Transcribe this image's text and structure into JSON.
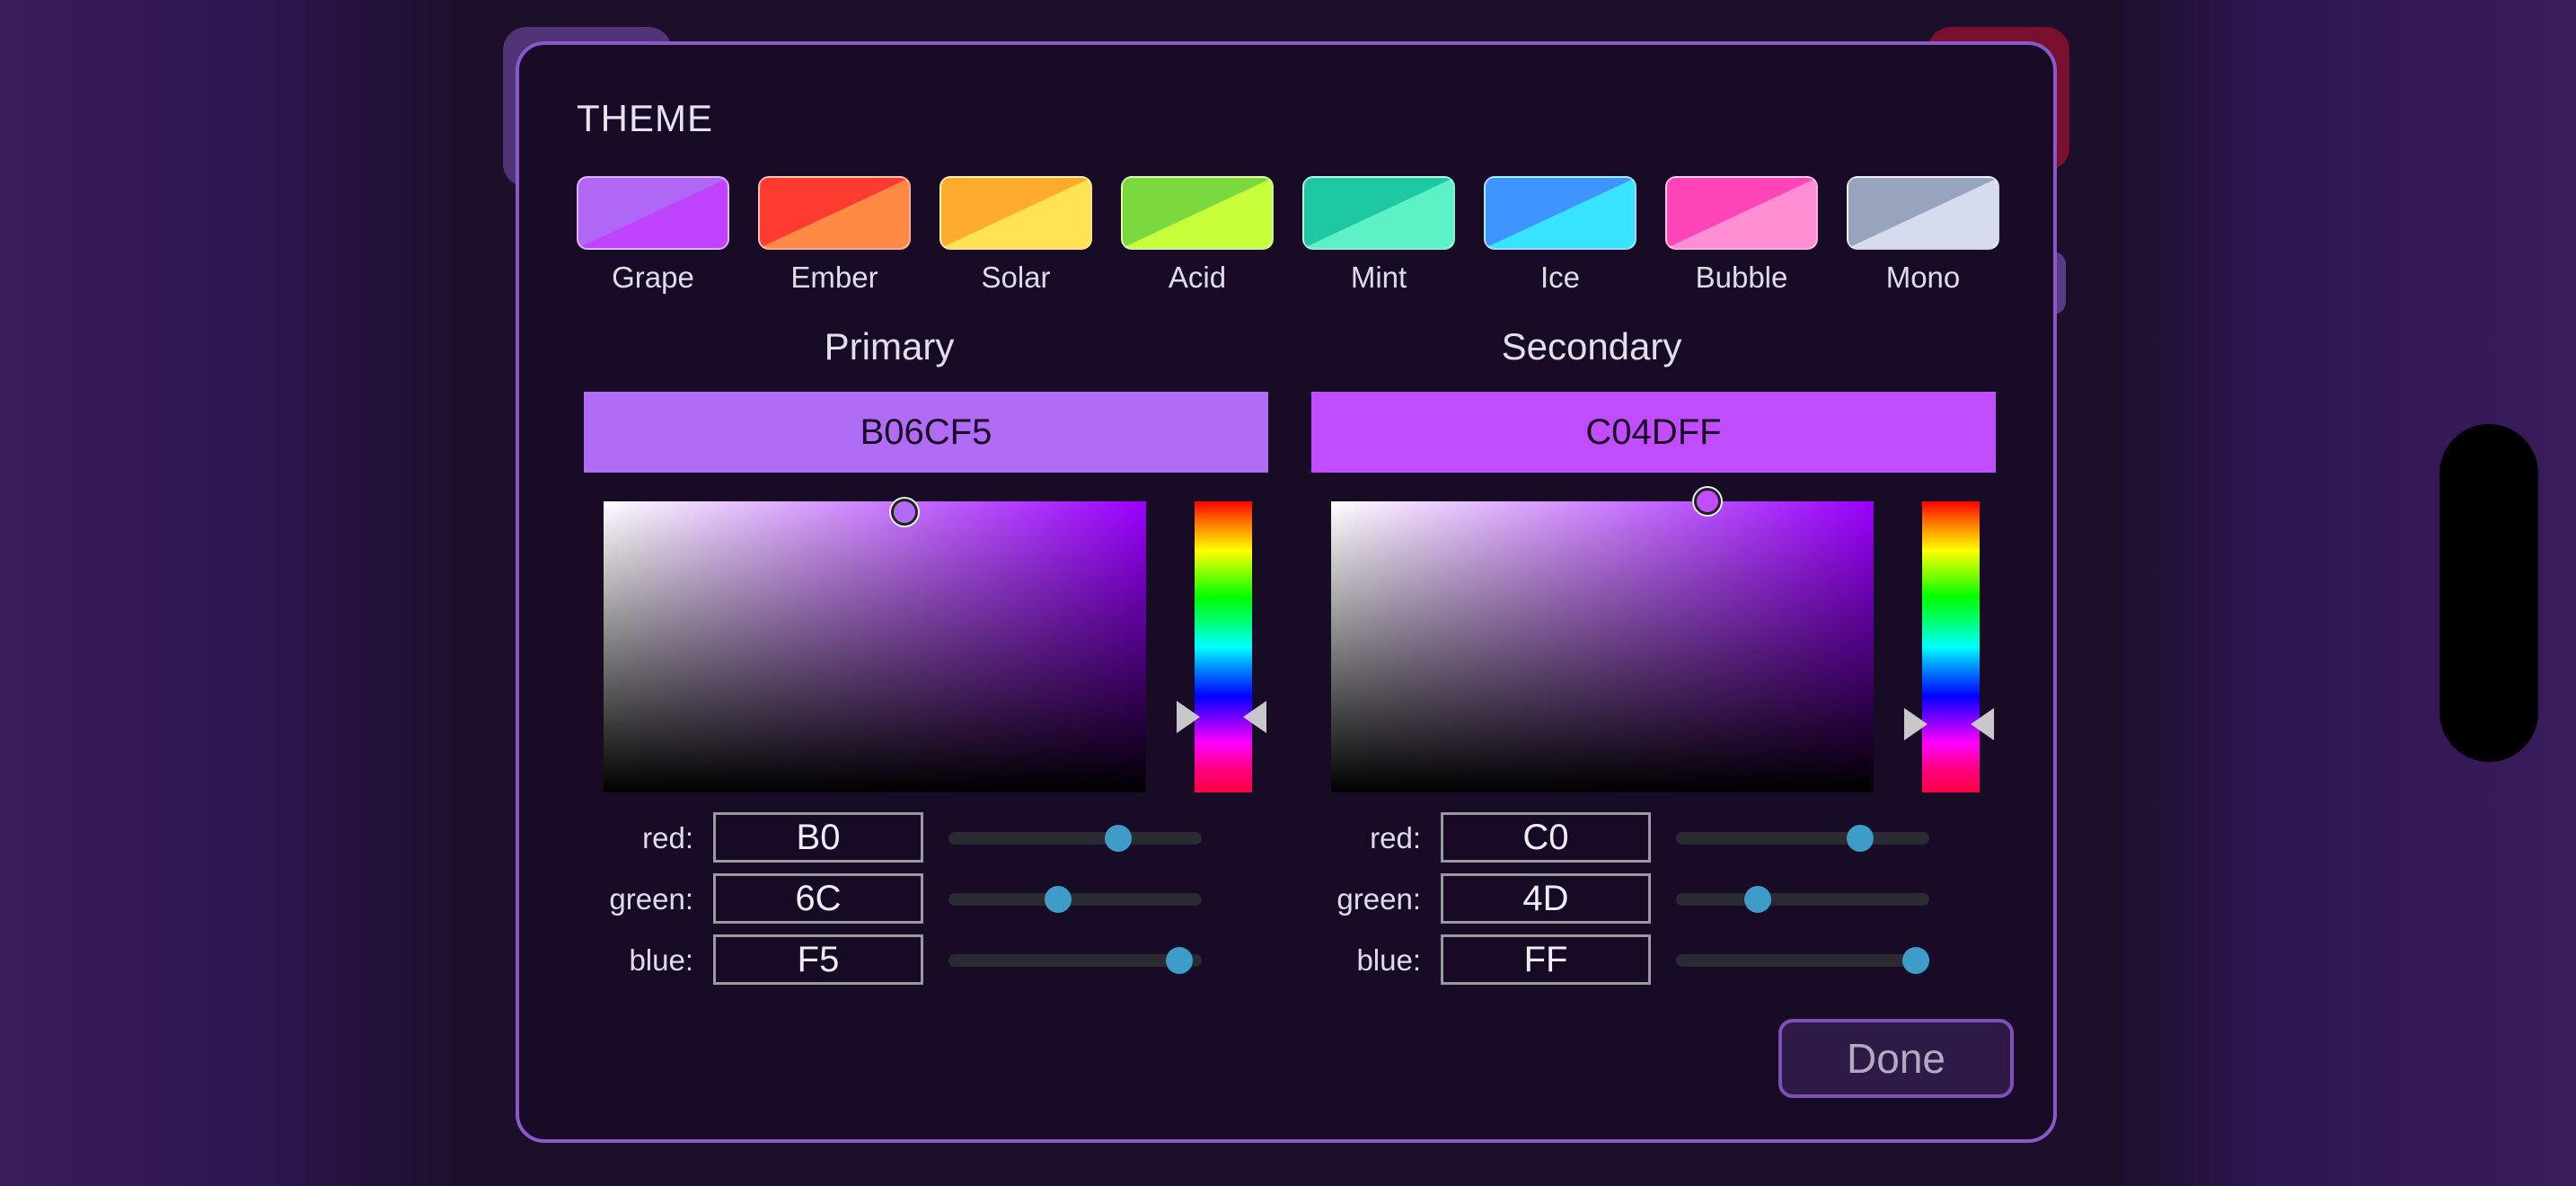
{
  "dialog": {
    "title": "THEME",
    "done_label": "Done"
  },
  "themes": [
    {
      "label": "Grape",
      "color_a": "#b067f5",
      "color_b": "#c043ff"
    },
    {
      "label": "Ember",
      "color_a": "#ff3b30",
      "color_b": "#ff8a45"
    },
    {
      "label": "Solar",
      "color_a": "#ffab2e",
      "color_b": "#ffe352"
    },
    {
      "label": "Acid",
      "color_a": "#7bd83f",
      "color_b": "#c8ff3a"
    },
    {
      "label": "Mint",
      "color_a": "#1ec8a3",
      "color_b": "#5df2c6"
    },
    {
      "label": "Ice",
      "color_a": "#3f95ff",
      "color_b": "#38e3ff"
    },
    {
      "label": "Bubble",
      "color_a": "#ff45b8",
      "color_b": "#ff8ed3"
    },
    {
      "label": "Mono",
      "color_a": "#98a3bd",
      "color_b": "#d6dcee"
    }
  ],
  "primary": {
    "title": "Primary",
    "hex": "B06CF5",
    "color": "#b06cf5",
    "hue_color": "#9a00ff",
    "red_label": "red:",
    "red": "B0",
    "green_label": "green:",
    "green": "6C",
    "blue_label": "blue:",
    "blue": "F5",
    "red_value": 176,
    "green_value": 108,
    "blue_value": 245
  },
  "secondary": {
    "title": "Secondary",
    "hex": "C04DFF",
    "color": "#c04dff",
    "hue_color": "#9a00ff",
    "red_label": "red:",
    "red": "C0",
    "green_label": "green:",
    "green": "4D",
    "blue_label": "blue:",
    "blue": "FF",
    "red_value": 192,
    "green_value": 77,
    "blue_value": 255
  }
}
